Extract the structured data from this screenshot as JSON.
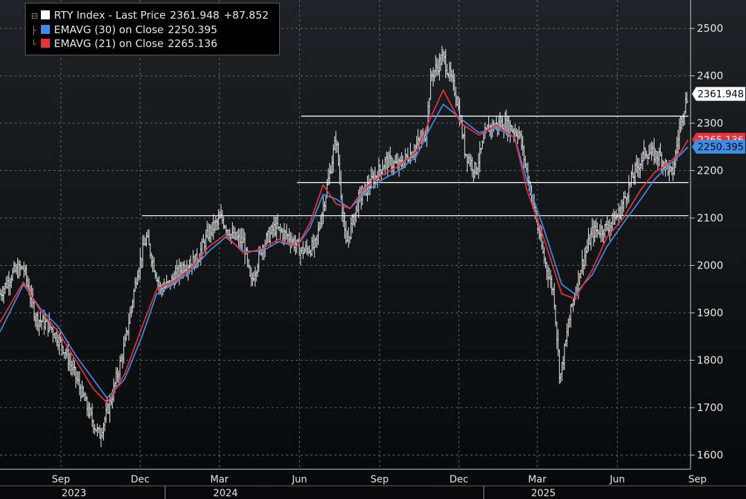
{
  "legend": {
    "items": [
      {
        "label": "RTY Index - Last Price",
        "value": "2361.948",
        "change": "+87.852",
        "color": "#ffffff"
      },
      {
        "label": "EMAVG (30)  on Close",
        "value": "2250.395",
        "change": "",
        "color": "#3d8ee8"
      },
      {
        "label": "EMAVG (21)  on Close",
        "value": "2265.136",
        "change": "",
        "color": "#e8323c"
      }
    ]
  },
  "chart_data": {
    "type": "line",
    "title": "",
    "ylim": [
      1570,
      2560
    ],
    "y_ticks": [
      1600,
      1700,
      1800,
      1900,
      2000,
      2100,
      2200,
      2300,
      2400,
      2500
    ],
    "x_month_labels": [
      "Sep",
      "Dec",
      "Mar",
      "Jun",
      "Sep",
      "Dec",
      "Mar",
      "Jun",
      "Sep"
    ],
    "x_year_labels": [
      "2023",
      "2024",
      "2025"
    ],
    "x_range": [
      "2023-07-05",
      "2025-09-05"
    ],
    "last_price_label": "2361.948",
    "ema30_label": "2250.395",
    "ema21_label": "2265.136",
    "horizontal_lines": [
      {
        "y": 2315,
        "x_start": "2024-06-15"
      },
      {
        "y": 2175,
        "x_start": "2024-06-10"
      },
      {
        "y": 2105,
        "x_start": "2023-12-15"
      }
    ],
    "series": [
      {
        "name": "RTY Index - Last Price",
        "color": "#ffffff",
        "x": [
          "2023-07-05",
          "2023-07-20",
          "2023-08-01",
          "2023-08-15",
          "2023-09-01",
          "2023-09-15",
          "2023-10-01",
          "2023-10-15",
          "2023-10-27",
          "2023-11-10",
          "2023-11-25",
          "2023-12-10",
          "2023-12-20",
          "2024-01-05",
          "2024-01-15",
          "2024-02-01",
          "2024-02-15",
          "2024-03-01",
          "2024-03-15",
          "2024-03-28",
          "2024-04-10",
          "2024-04-18",
          "2024-05-01",
          "2024-05-15",
          "2024-06-01",
          "2024-06-15",
          "2024-07-01",
          "2024-07-16",
          "2024-07-25",
          "2024-08-05",
          "2024-08-20",
          "2024-09-05",
          "2024-09-20",
          "2024-10-05",
          "2024-10-20",
          "2024-11-05",
          "2024-11-11",
          "2024-11-25",
          "2024-12-10",
          "2024-12-20",
          "2025-01-01",
          "2025-01-15",
          "2025-02-01",
          "2025-02-20",
          "2025-03-05",
          "2025-03-20",
          "2025-04-01",
          "2025-04-08",
          "2025-04-20",
          "2025-05-01",
          "2025-05-15",
          "2025-06-01",
          "2025-06-15",
          "2025-07-01",
          "2025-07-15",
          "2025-08-01",
          "2025-08-15",
          "2025-08-25",
          "2025-09-02"
        ],
        "y": [
          1940,
          1985,
          1995,
          1890,
          1870,
          1830,
          1760,
          1690,
          1640,
          1720,
          1830,
          1990,
          2060,
          1950,
          1960,
          2000,
          2010,
          2070,
          2100,
          2060,
          2050,
          1960,
          2040,
          2080,
          2060,
          2030,
          2040,
          2180,
          2270,
          2040,
          2140,
          2180,
          2220,
          2210,
          2240,
          2280,
          2400,
          2440,
          2360,
          2240,
          2200,
          2290,
          2300,
          2280,
          2160,
          2020,
          1940,
          1760,
          1900,
          1990,
          2070,
          2080,
          2110,
          2190,
          2240,
          2230,
          2190,
          2310,
          2362
        ]
      },
      {
        "name": "EMAVG (30)  on Close",
        "color": "#3d8ee8",
        "x": [
          "2023-07-05",
          "2023-08-01",
          "2023-08-20",
          "2023-09-10",
          "2023-09-30",
          "2023-10-20",
          "2023-11-05",
          "2023-11-25",
          "2023-12-15",
          "2024-01-01",
          "2024-01-20",
          "2024-02-10",
          "2024-03-01",
          "2024-03-20",
          "2024-04-10",
          "2024-05-01",
          "2024-05-20",
          "2024-06-10",
          "2024-06-25",
          "2024-07-10",
          "2024-07-25",
          "2024-08-10",
          "2024-08-25",
          "2024-09-15",
          "2024-10-05",
          "2024-10-25",
          "2024-11-10",
          "2024-11-25",
          "2024-12-15",
          "2025-01-05",
          "2025-01-25",
          "2025-02-15",
          "2025-03-01",
          "2025-03-20",
          "2025-04-10",
          "2025-04-25",
          "2025-05-15",
          "2025-06-01",
          "2025-06-20",
          "2025-07-10",
          "2025-07-25",
          "2025-08-10",
          "2025-08-25",
          "2025-09-02"
        ],
        "y": [
          1860,
          1960,
          1910,
          1870,
          1810,
          1760,
          1720,
          1760,
          1850,
          1940,
          1960,
          1990,
          2030,
          2060,
          2030,
          2030,
          2050,
          2040,
          2080,
          2150,
          2140,
          2120,
          2150,
          2180,
          2200,
          2230,
          2290,
          2340,
          2310,
          2280,
          2290,
          2270,
          2180,
          2080,
          1960,
          1940,
          1980,
          2040,
          2090,
          2140,
          2180,
          2210,
          2235,
          2250
        ]
      },
      {
        "name": "EMAVG (21)  on Close",
        "color": "#e8323c",
        "x": [
          "2023-07-05",
          "2023-08-01",
          "2023-08-20",
          "2023-09-10",
          "2023-09-30",
          "2023-10-20",
          "2023-11-05",
          "2023-11-25",
          "2023-12-15",
          "2024-01-01",
          "2024-01-20",
          "2024-02-10",
          "2024-03-01",
          "2024-03-20",
          "2024-04-10",
          "2024-05-01",
          "2024-05-20",
          "2024-06-10",
          "2024-06-25",
          "2024-07-10",
          "2024-07-25",
          "2024-08-10",
          "2024-08-25",
          "2024-09-15",
          "2024-10-05",
          "2024-10-25",
          "2024-11-10",
          "2024-11-25",
          "2024-12-15",
          "2025-01-05",
          "2025-01-25",
          "2025-02-15",
          "2025-03-01",
          "2025-03-20",
          "2025-04-10",
          "2025-04-25",
          "2025-05-15",
          "2025-06-01",
          "2025-06-20",
          "2025-07-10",
          "2025-07-25",
          "2025-08-10",
          "2025-08-25",
          "2025-09-02"
        ],
        "y": [
          1880,
          1965,
          1905,
          1860,
          1800,
          1740,
          1710,
          1770,
          1870,
          1950,
          1965,
          1995,
          2040,
          2065,
          2025,
          2035,
          2055,
          2040,
          2090,
          2170,
          2130,
          2120,
          2160,
          2190,
          2210,
          2240,
          2310,
          2370,
          2300,
          2275,
          2295,
          2270,
          2160,
          2060,
          1940,
          1930,
          1990,
          2060,
          2100,
          2160,
          2195,
          2215,
          2240,
          2265
        ]
      }
    ]
  }
}
